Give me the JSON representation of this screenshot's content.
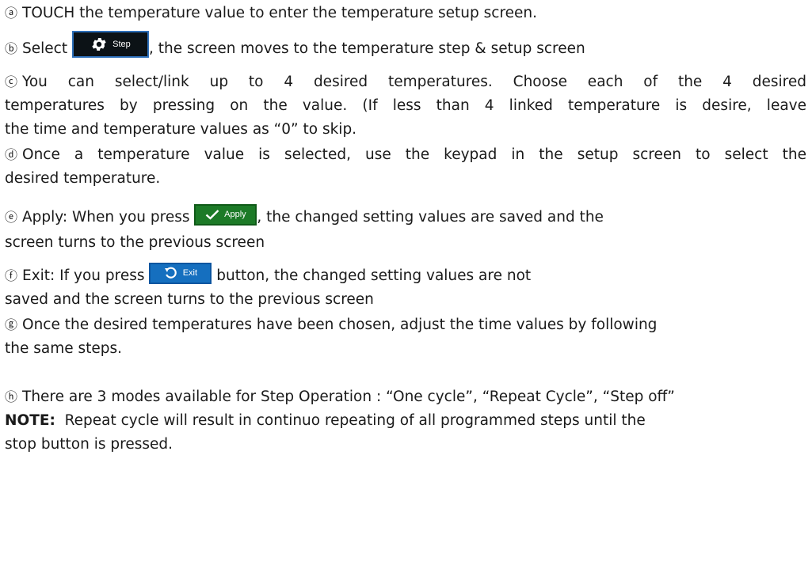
{
  "items": [
    {
      "marker": "ⓐ",
      "text": "TOUCH the temperature value to enter the temperature setup screen."
    },
    {
      "marker": "ⓑ",
      "pre": "Select",
      "post": ", the screen moves to the temperature step & setup screen"
    },
    {
      "marker": "ⓒ",
      "line1": "You can select/link up to 4 desired temperatures.  Choose each of the 4 desired",
      "line2": "temperatures by pressing on the value.  (If less than 4 linked temperature is desire, leave",
      "line3": "the time and temperature values as “0” to skip."
    },
    {
      "marker": "ⓓ",
      "line1": "Once a temperature value is selected, use the keypad in the setup screen to select the",
      "line2": "desired temperature."
    },
    {
      "marker": "ⓔ",
      "pre": "Apply: When you press",
      "post": ",  the changed setting values are saved and the",
      "line2": "screen turns to the previous screen"
    },
    {
      "marker": "ⓕ",
      "pre": "Exit: If you press",
      "post": "button, the changed setting values are not",
      "line2": "saved and the screen turns to the previous screen"
    },
    {
      "marker": "ⓖ",
      "line1": "Once the desired temperatures have been chosen, adjust the time values by following",
      "line2": "the same steps."
    },
    {
      "marker": "ⓗ",
      "line1": "There are 3 modes available for Step Operation : “One cycle”, “Repeat Cycle”, “Step off”"
    }
  ],
  "note": {
    "label": "NOTE:",
    "line1": "  Repeat cycle will result in continuo repeating of all programmed steps until the",
    "line2": "stop button is pressed."
  },
  "buttons": {
    "step": {
      "label": "Step",
      "icon": "gear-icon",
      "color": "#0c1216"
    },
    "apply": {
      "label": "Apply",
      "icon": "check-icon",
      "color": "#1c7a27"
    },
    "exit": {
      "label": "Exit",
      "icon": "undo-icon",
      "color": "#156fbf"
    }
  }
}
